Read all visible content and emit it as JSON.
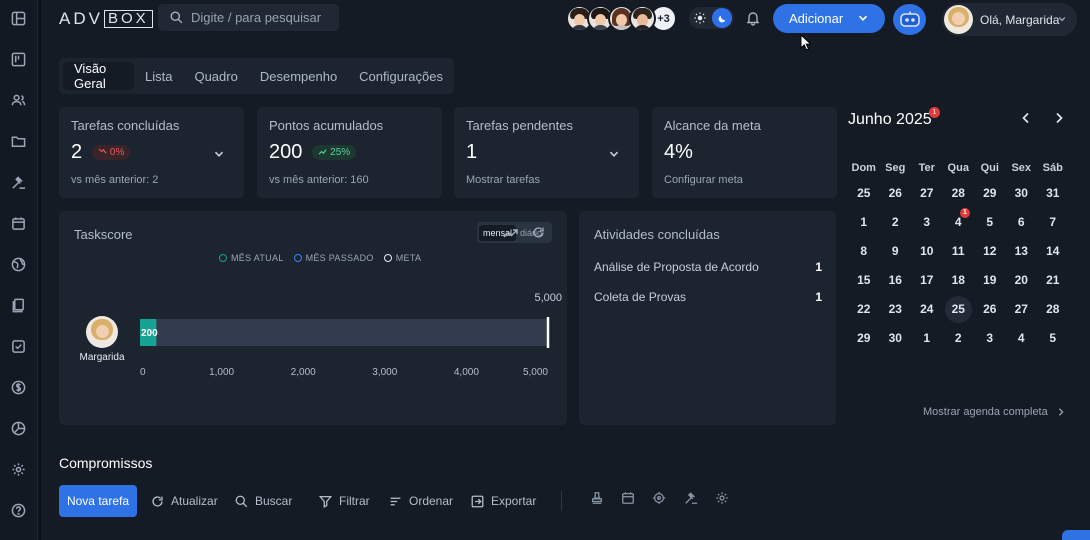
{
  "header": {
    "logo_text": "ADV",
    "logo_box": "BOX",
    "search_placeholder": "Digite / para pesquisar",
    "more_count": "+3",
    "add_button": "Adicionar",
    "greeting": "Olá, Margarida"
  },
  "tabs": [
    {
      "label": "Visão Geral",
      "active": true
    },
    {
      "label": "Lista"
    },
    {
      "label": "Quadro"
    },
    {
      "label": "Desempenho"
    },
    {
      "label": "Configurações"
    }
  ],
  "stats": [
    {
      "label": "Tarefas concluídas",
      "value": "2",
      "badge": "0%",
      "sub": "vs mês anterior: 2"
    },
    {
      "label": "Pontos acumulados",
      "value": "200",
      "badge": "25%",
      "sub": "vs mês anterior: 160"
    },
    {
      "label": "Tarefas pendentes",
      "value": "1",
      "sub": "Mostrar tarefas"
    },
    {
      "label": "Alcance da meta",
      "value": "4%",
      "sub": "Configurar meta"
    }
  ],
  "taskscore": {
    "title": "Taskscore",
    "toggle": [
      "mensal",
      "diário"
    ],
    "legend": [
      "MÊS ATUAL",
      "MÊS PASSADO",
      "META"
    ]
  },
  "chart_data": {
    "type": "bar",
    "orientation": "horizontal",
    "categories": [
      "Margarida"
    ],
    "series": [
      {
        "name": "MÊS ATUAL",
        "values": [
          200
        ]
      }
    ],
    "target": 5000,
    "target_label": "5,000",
    "value_labels": [
      "200"
    ],
    "xlim": [
      0,
      5000
    ],
    "xticks": [
      "0",
      "1,000",
      "2,000",
      "3,000",
      "4,000",
      "5,000"
    ],
    "colors": {
      "current": "#16a394",
      "track": "#333c4c",
      "meta": "#ffffff"
    }
  },
  "atividades": {
    "title": "Atividades concluídas",
    "items": [
      {
        "label": "Análise de Proposta de Acordo",
        "count": "1"
      },
      {
        "label": "Coleta de Provas",
        "count": "1"
      }
    ]
  },
  "calendar": {
    "title": "Junho 2025",
    "badge": "1",
    "weekdays": [
      "Dom",
      "Seg",
      "Ter",
      "Qua",
      "Qui",
      "Sex",
      "Sáb"
    ],
    "weeks": [
      [
        [
          "25",
          "dim"
        ],
        [
          "26",
          "dim"
        ],
        [
          "27",
          "dim"
        ],
        [
          "28",
          "dim"
        ],
        [
          "29",
          "dim"
        ],
        [
          "30",
          "dim"
        ],
        [
          "31",
          "dim"
        ]
      ],
      [
        [
          "1",
          ""
        ],
        [
          "2",
          ""
        ],
        [
          "3",
          ""
        ],
        [
          "4",
          "badge"
        ],
        [
          "5",
          ""
        ],
        [
          "6",
          ""
        ],
        [
          "7",
          ""
        ]
      ],
      [
        [
          "8",
          ""
        ],
        [
          "9",
          ""
        ],
        [
          "10",
          ""
        ],
        [
          "11",
          ""
        ],
        [
          "12",
          ""
        ],
        [
          "13",
          ""
        ],
        [
          "14",
          ""
        ]
      ],
      [
        [
          "15",
          ""
        ],
        [
          "16",
          ""
        ],
        [
          "17",
          ""
        ],
        [
          "18",
          ""
        ],
        [
          "19",
          ""
        ],
        [
          "20",
          ""
        ],
        [
          "21",
          ""
        ]
      ],
      [
        [
          "22",
          ""
        ],
        [
          "23",
          ""
        ],
        [
          "24",
          ""
        ],
        [
          "25",
          "today"
        ],
        [
          "26",
          ""
        ],
        [
          "27",
          ""
        ],
        [
          "28",
          ""
        ]
      ],
      [
        [
          "29",
          ""
        ],
        [
          "30",
          ""
        ],
        [
          "1",
          "dim"
        ],
        [
          "2",
          "dim"
        ],
        [
          "3",
          "dim"
        ],
        [
          "4",
          "dim"
        ],
        [
          "5",
          "dim"
        ]
      ]
    ],
    "day_badge": "1",
    "link": "Mostrar agenda completa"
  },
  "compromissos": {
    "title": "Compromissos",
    "new_task": "Nova tarefa",
    "actions": [
      "Atualizar",
      "Buscar",
      "Filtrar",
      "Ordenar",
      "Exportar"
    ]
  },
  "colors": {
    "accent": "#2f72e6",
    "bg": "#141b25",
    "card": "#1c2430",
    "success": "#57d39b",
    "danger": "#ea5b5b"
  }
}
